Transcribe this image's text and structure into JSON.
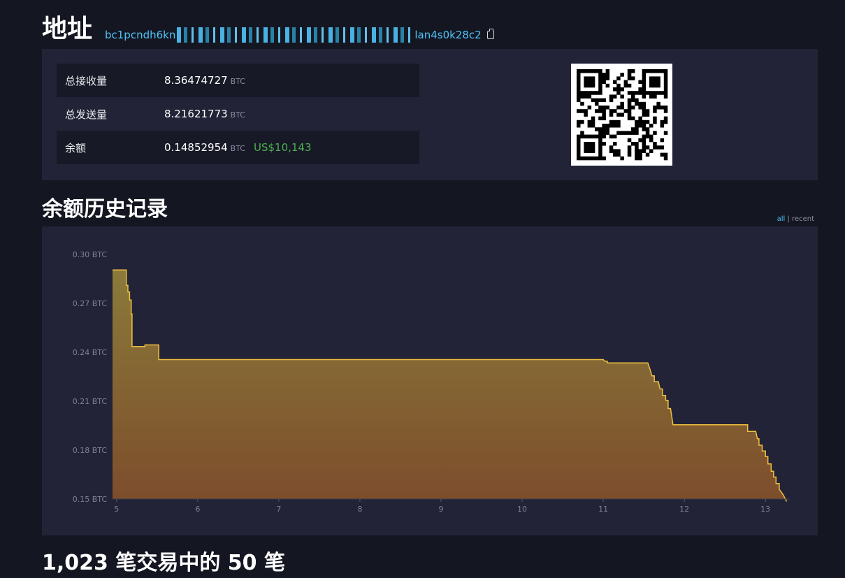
{
  "header": {
    "title": "地址",
    "address_start": "bc1pcndh6kn",
    "address_end": "lan4s0k28c2"
  },
  "summary": {
    "rows": [
      {
        "label": "总接收量",
        "value": "8.36474727",
        "unit": "BTC"
      },
      {
        "label": "总发送量",
        "value": "8.21621773",
        "unit": "BTC"
      },
      {
        "label": "余额",
        "value": "0.14852954",
        "unit": "BTC",
        "usd": "US$10,143"
      }
    ]
  },
  "balance_history": {
    "title": "余额历史记录",
    "toggle": {
      "all": "all",
      "separator": "|",
      "recent": "recent"
    }
  },
  "transactions": {
    "title": "1,023 笔交易中的 50 笔"
  },
  "chart_data": {
    "type": "area",
    "ylim": [
      0.15,
      0.3
    ],
    "xlim": [
      4.95,
      13.3
    ],
    "y_ticks": [
      "0.30 BTC",
      "0.27 BTC",
      "0.24 BTC",
      "0.21 BTC",
      "0.18 BTC",
      "0.15 BTC"
    ],
    "y_tick_values": [
      0.3,
      0.27,
      0.24,
      0.21,
      0.18,
      0.15
    ],
    "x_ticks": [
      "5",
      "6",
      "7",
      "8",
      "9",
      "10",
      "11",
      "12",
      "13"
    ],
    "x_tick_values": [
      5,
      6,
      7,
      8,
      9,
      10,
      11,
      12,
      13
    ],
    "colors": {
      "line": "#f0c040",
      "fill_top": "#8a7a3a",
      "fill_bottom": "#7d4d2c"
    },
    "series": [
      {
        "points": [
          [
            4.95,
            0.2905
          ],
          [
            5.12,
            0.2905
          ],
          [
            5.12,
            0.281
          ],
          [
            5.14,
            0.281
          ],
          [
            5.14,
            0.277
          ],
          [
            5.16,
            0.277
          ],
          [
            5.16,
            0.272
          ],
          [
            5.18,
            0.272
          ],
          [
            5.18,
            0.2635
          ],
          [
            5.19,
            0.2635
          ],
          [
            5.19,
            0.2435
          ],
          [
            5.35,
            0.2435
          ],
          [
            5.35,
            0.2445
          ],
          [
            5.52,
            0.2445
          ],
          [
            5.52,
            0.2355
          ],
          [
            11.0,
            0.2355
          ],
          [
            11.02,
            0.2345
          ],
          [
            11.05,
            0.2345
          ],
          [
            11.05,
            0.2335
          ],
          [
            11.55,
            0.2335
          ],
          [
            11.58,
            0.229
          ],
          [
            11.6,
            0.2255
          ],
          [
            11.63,
            0.2255
          ],
          [
            11.63,
            0.222
          ],
          [
            11.68,
            0.222
          ],
          [
            11.7,
            0.2175
          ],
          [
            11.73,
            0.2175
          ],
          [
            11.73,
            0.2135
          ],
          [
            11.77,
            0.2135
          ],
          [
            11.77,
            0.2105
          ],
          [
            11.8,
            0.2105
          ],
          [
            11.8,
            0.2055
          ],
          [
            11.83,
            0.2055
          ],
          [
            11.86,
            0.1955
          ],
          [
            12.78,
            0.1955
          ],
          [
            12.78,
            0.1915
          ],
          [
            12.88,
            0.1915
          ],
          [
            12.9,
            0.187
          ],
          [
            12.92,
            0.187
          ],
          [
            12.92,
            0.183
          ],
          [
            12.96,
            0.183
          ],
          [
            12.96,
            0.1795
          ],
          [
            13.0,
            0.1795
          ],
          [
            13.0,
            0.176
          ],
          [
            13.03,
            0.176
          ],
          [
            13.03,
            0.1715
          ],
          [
            13.07,
            0.1715
          ],
          [
            13.07,
            0.167
          ],
          [
            13.1,
            0.167
          ],
          [
            13.1,
            0.1635
          ],
          [
            13.13,
            0.1635
          ],
          [
            13.13,
            0.1595
          ],
          [
            13.17,
            0.1595
          ],
          [
            13.17,
            0.156
          ],
          [
            13.22,
            0.1525
          ],
          [
            13.26,
            0.1485
          ]
        ]
      }
    ]
  }
}
